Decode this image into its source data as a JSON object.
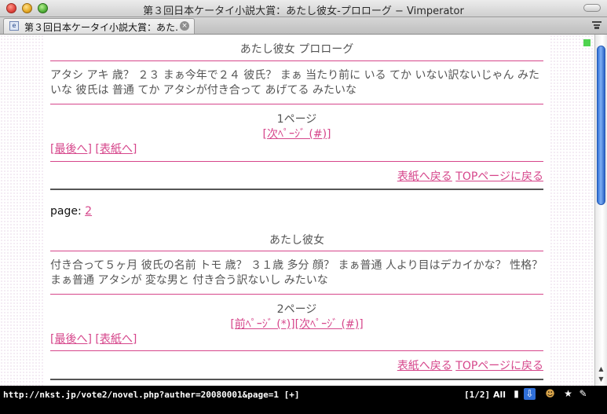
{
  "window": {
    "title": "第３回日本ケータイ小説大賞：あたし彼女-プロローグ − Vimperator"
  },
  "tabs": [
    {
      "label": "第３回日本ケータイ小説大賞：あた…"
    }
  ],
  "page": {
    "section1": {
      "heading": "あたし彼女 プロローグ",
      "body": "アタシ アキ 歳？ ２３ まぁ今年で２４ 彼氏？ まぁ 当たり前に いる てか いない訳ないじゃん みたいな 彼氏は 普通 てか アタシが付き合って あげてる みたいな",
      "page_label": "1ページ",
      "next_link": "[次ﾍﾟｰｼﾞ (#)]",
      "last_link": "[最後へ]",
      "cover_link": "[表紙へ]",
      "back_cover": "表紙へ戻る",
      "back_top": "TOPページに戻る"
    },
    "pager": {
      "label": "page: ",
      "link": "2"
    },
    "section2": {
      "heading": "あたし彼女",
      "body": "付き合って５ヶ月 彼氏の名前 トモ 歳？ ３１歳 多分 顔？ まぁ普通 人より目はデカイかな？ 性格？ まぁ普通 アタシが 変な男と 付き合う訳ないし みたいな",
      "page_label": "2ページ",
      "prev_link": "[前ﾍﾟｰｼﾞ (*)]",
      "next_link": "[次ﾍﾟｰｼﾞ (#)]",
      "last_link": "[最後へ]",
      "cover_link": "[表紙へ]",
      "back_cover": "表紙へ戻る",
      "back_top": "TOPページに戻る"
    }
  },
  "statusbar": {
    "url": "http://nkst.jp/vote2/novel.php?auther=20080001&page=1 [+]",
    "position": "[1/2]",
    "scroll": "All"
  },
  "icons": {
    "close": "close-icon",
    "minimize": "minimize-icon",
    "zoom": "zoom-icon",
    "toolbar_toggle": "toolbar-toggle-icon",
    "tab_favicon": "page-icon",
    "tab_close": "tab-close-icon",
    "tab_list": "tab-list-icon"
  },
  "colors": {
    "link": "#d6468b",
    "scrollbar_thumb": "#2f6fd8",
    "indicator": "#4fd34f"
  }
}
